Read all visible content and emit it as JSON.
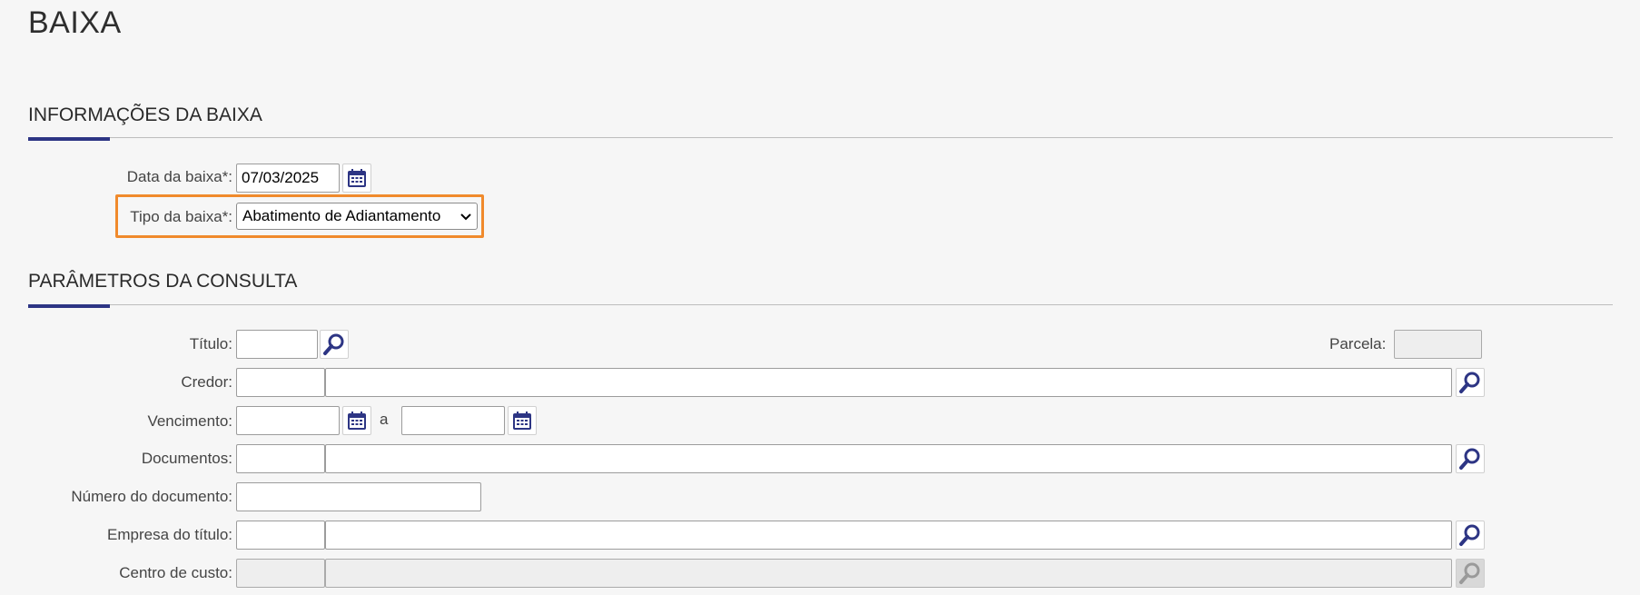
{
  "page": {
    "title": "BAIXA"
  },
  "info_section": {
    "title": "INFORMAÇÕES DA BAIXA",
    "data_baixa_label": "Data da baixa*:",
    "data_baixa_value": "07/03/2025",
    "tipo_baixa_label": "Tipo da baixa*:",
    "tipo_baixa_value": "Abatimento de Adiantamento",
    "highlight_color": "#f08a2c"
  },
  "params_section": {
    "title": "PARÂMETROS DA CONSULTA",
    "titulo_label": "Título:",
    "parcela_label": "Parcela:",
    "credor_label": "Credor:",
    "vencimento_label": "Vencimento:",
    "vencimento_sep": "a",
    "documentos_label": "Documentos:",
    "numero_documento_label": "Número do documento:",
    "empresa_titulo_label": "Empresa do título:",
    "centro_custo_label": "Centro de custo:"
  },
  "colors": {
    "accent": "#2d3584"
  },
  "icons": [
    "calendar-icon",
    "search-icon",
    "chevron-down-icon"
  ]
}
